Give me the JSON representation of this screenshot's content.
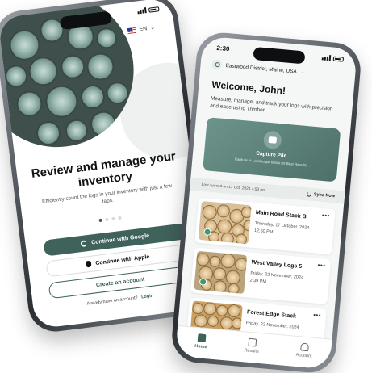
{
  "left_phone": {
    "status_time": "",
    "language": "EN",
    "title": "Review and manage your inventory",
    "subtitle": "Efficiently count the logs in your inventory with just a few taps.",
    "buttons": {
      "google": "Continue with Google",
      "apple": "Continue with Apple",
      "create": "Create an account"
    },
    "login_prompt": "Already have an account?",
    "login_link": "Login"
  },
  "right_phone": {
    "status_time": "2:30",
    "location": "Eastwood District, Maine, USA",
    "welcome": "Welcome, John!",
    "welcome_sub": "Measure, manage, and track your logs with precision and ease using Trimber",
    "capture": {
      "title": "Capture Pile",
      "subtitle": "Capture in Landscape Mode for Best Results"
    },
    "last_synced": "Last synced on 17 Oct, 2024 4:53 pm",
    "sync_label": "Sync Now",
    "cards": [
      {
        "name": "Main Road Stack B",
        "date": "Thursday, 17 October, 2024",
        "time": "12:50 PM"
      },
      {
        "name": "West Valley Logs 5",
        "date": "Friday, 22 November, 2024",
        "time": "2:39 PM"
      },
      {
        "name": "Forest Edge Stack",
        "date": "Friday, 22 November, 2024",
        "time": ""
      }
    ],
    "more_label": "•••",
    "tabs": {
      "home": "Home",
      "results": "Results",
      "account": "Account"
    }
  },
  "colors": {
    "primary": "#3f625b",
    "success": "#3f9a6f"
  }
}
